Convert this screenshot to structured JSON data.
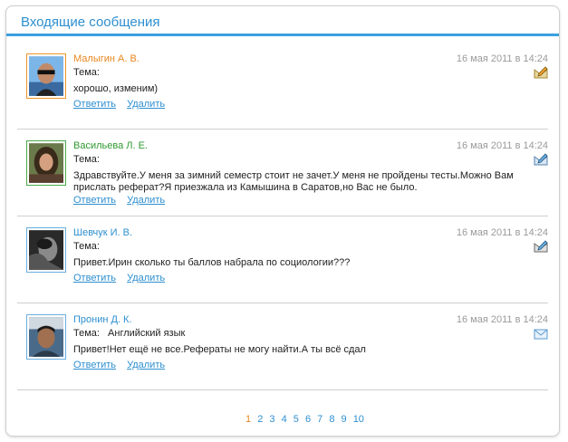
{
  "header": {
    "title": "Входящие сообщения"
  },
  "messages": [
    {
      "author": "Малыгин А. В.",
      "date": "16 мая 2011 в 14:24",
      "subject_label": "Тема:",
      "subject": "",
      "body": "хорошо, изменим)",
      "reply": "Ответить",
      "delete": "Удалить",
      "icon": "read-edit-icon"
    },
    {
      "author": "Васильева Л. Е.",
      "date": "16 мая 2011 в 14:24",
      "subject_label": "Тема:",
      "subject": "",
      "body": "Здравствуйте.У меня за зимний семестр стоит не зачет.У меня не пройдены тесты.Можно Вам прислать реферат?Я приезжала из Камышина в Саратов,но Вас не было.",
      "reply": "Ответить",
      "delete": "Удалить",
      "icon": "read-edit-icon"
    },
    {
      "author": "Шевчук И. В.",
      "date": "16 мая 2011 в 14:24",
      "subject_label": "Тема:",
      "subject": "",
      "body": "Привет.Ирин сколько ты баллов набрала по социологии???",
      "reply": "Ответить",
      "delete": "Удалить",
      "icon": "read-edit-icon"
    },
    {
      "author": "Пронин Д. К.",
      "date": "16 мая 2011 в 14:24",
      "subject_label": "Тема:",
      "subject": "Английский язык",
      "body": "Привет!Нет ещё не все.Рефераты не могу найти.А ты всё сдал",
      "reply": "Ответить",
      "delete": "Удалить",
      "icon": "envelope-icon"
    }
  ],
  "pagination": {
    "current": "1",
    "pages": [
      "2",
      "3",
      "4",
      "5",
      "6",
      "7",
      "8",
      "9",
      "10"
    ]
  },
  "colors": {
    "accent": "#2e8fd0",
    "orange": "#e8871e",
    "green": "#2f9a2f",
    "date": "#9a9a9a"
  }
}
